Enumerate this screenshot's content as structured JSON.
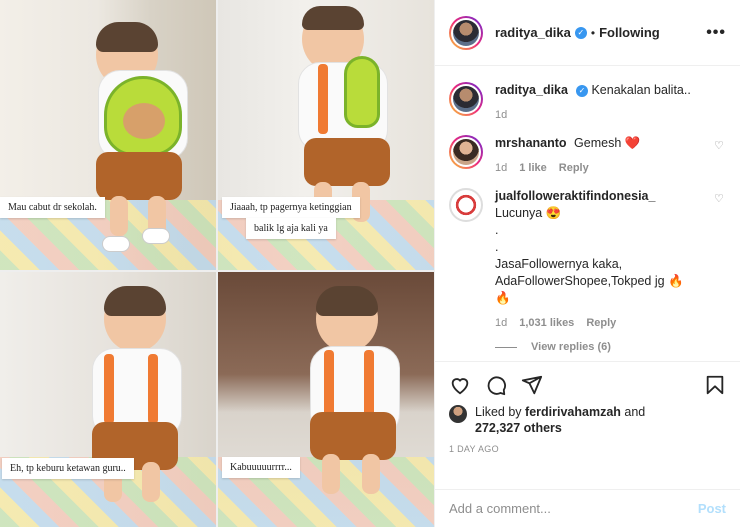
{
  "post": {
    "captions": [
      "Mau cabut dr sekolah.",
      "Jiaaah, tp pagernya ketinggian",
      "balik lg aja kali ya",
      "Eh, tp keburu ketawan guru..",
      "Kabuuuuurrrr..."
    ]
  },
  "header": {
    "username": "raditya_dika",
    "verified_mark": "✓",
    "separator": "•",
    "follow_label": "Following",
    "more_label": "•••"
  },
  "comments": [
    {
      "username": "raditya_dika",
      "text": "Kenakalan balita..",
      "time": "1d",
      "likes": "",
      "reply": ""
    },
    {
      "username": "mrshananto",
      "text": "Gemesh ❤️",
      "time": "1d",
      "likes": "1 like",
      "reply": "Reply"
    },
    {
      "username": "jualfolloweraktifindonesia_",
      "text": "Lucunya 😍",
      "extra": [
        ".",
        ".",
        "JasaFollowernya kaka,",
        "AdaFollowerShopee,Tokped jg 🔥",
        "🔥"
      ],
      "time": "1d",
      "likes": "1,031 likes",
      "reply": "Reply"
    }
  ],
  "view_replies": "View replies (6)",
  "likes": {
    "prefix": "Liked by",
    "user": "ferdirivahamzah",
    "and": "and",
    "count": "272,327 others"
  },
  "timestamp": "1 DAY AGO",
  "composer": {
    "placeholder": "Add a comment...",
    "post_label": "Post"
  },
  "icons": {
    "like": "heart-icon",
    "comment": "comment-icon",
    "share": "share-icon",
    "save": "bookmark-icon"
  },
  "colors": {
    "verified": "#3897f0",
    "link_blue": "#b2dffc",
    "muted": "#8e8e8e"
  }
}
